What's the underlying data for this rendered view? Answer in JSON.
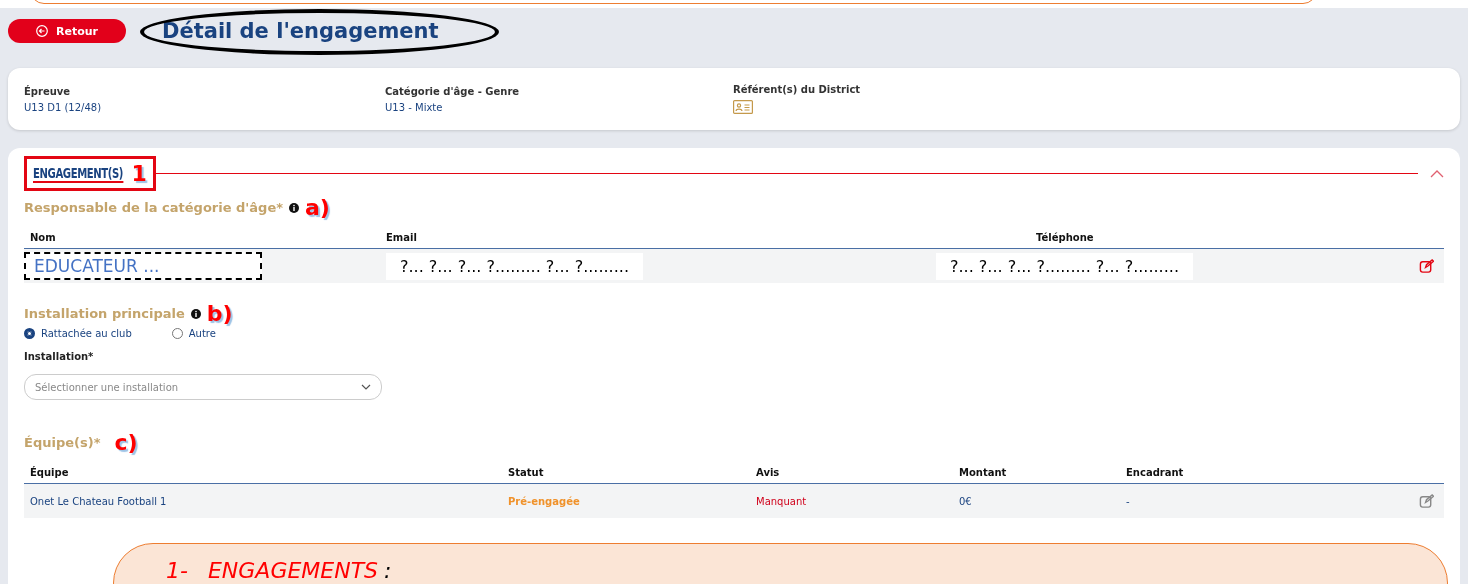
{
  "header": {
    "back_button": "Retour",
    "title": "Détail de l'engagement"
  },
  "info": [
    {
      "label": "Épreuve",
      "value": "U13 D1 (12/48)"
    },
    {
      "label": "Catégorie d'âge - Genre",
      "value": "U13 - Mixte"
    },
    {
      "label": "Référent(s) du District"
    }
  ],
  "engagements": {
    "title": "ENGAGEMENT(S)",
    "marker": "1",
    "expanded": true,
    "responsable": {
      "title": "Responsable de la catégorie d'âge*",
      "marker": "a)",
      "columns": [
        "Nom",
        "Email",
        "Téléphone"
      ],
      "row": {
        "nom": "EDUCATEUR ...",
        "email": "?... ?... ?... ?......... ?... ?.........",
        "telephone": "?... ?... ?... ?......... ?... ?........."
      }
    },
    "installation": {
      "title": "Installation principale",
      "marker": "b)",
      "options": [
        {
          "label": "Rattachée au club",
          "selected": true
        },
        {
          "label": "Autre",
          "selected": false
        }
      ],
      "field_label": "Installation*",
      "placeholder": "Sélectionner une installation"
    },
    "equipes": {
      "title": "Équipe(s)*",
      "marker": "c)",
      "columns": [
        "Équipe",
        "Statut",
        "Avis",
        "Montant",
        "Encadrant"
      ],
      "rows": [
        {
          "equipe": "Onet Le Chateau Football 1",
          "statut": "Pré-engagée",
          "avis": "Manquant",
          "montant": "0€",
          "encadrant": "-"
        }
      ]
    }
  },
  "callout": {
    "number": "1-",
    "title": "ENGAGEMENTS",
    "suffix": ":"
  }
}
